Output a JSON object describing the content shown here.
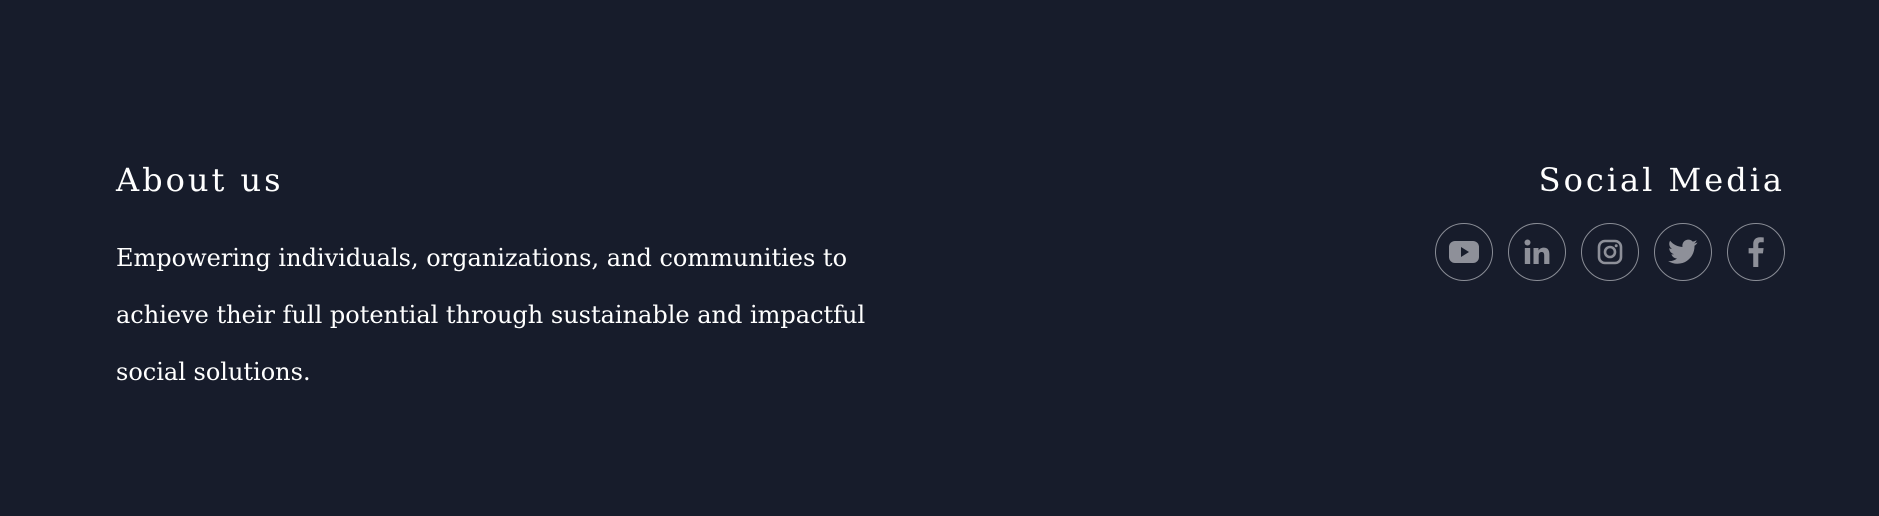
{
  "about": {
    "title": "About us",
    "text": "Empowering individuals, organizations, and communities to achieve their full potential through sustainable and impactful social solutions."
  },
  "social": {
    "title": "Social Media",
    "icons": [
      "youtube-icon",
      "linkedin-icon",
      "instagram-icon",
      "twitter-icon",
      "facebook-icon"
    ],
    "icon_color": "#8e9099",
    "border_color": "#8a8d96"
  },
  "colors": {
    "background": "#171c2b",
    "text": "#ffffff"
  }
}
